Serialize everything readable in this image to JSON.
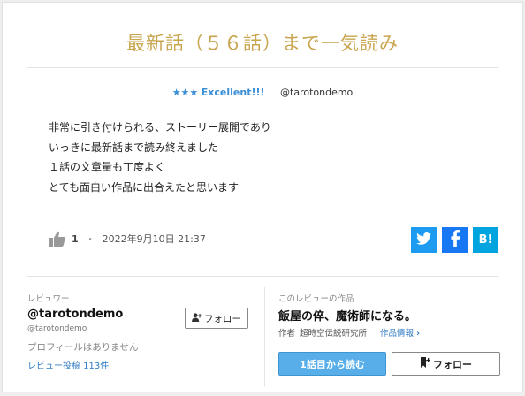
{
  "review": {
    "title": "最新話（５６話）まで一気読み",
    "stars": "★★★",
    "rating_label": "Excellent!!!",
    "reviewer_handle": "@tarotondemo",
    "body_lines": [
      "非常に引き付けられる、ストーリー展開であり",
      "いっきに最新話まで読み終えました",
      "１話の文章量も丁度よく",
      "とても面白い作品に出合えたと思います"
    ],
    "like_count": "1",
    "separator": "・",
    "date": "2022年9月10日 21:37"
  },
  "share": {
    "twitter_icon": "twitter-icon",
    "facebook_icon": "facebook-icon",
    "hatena_label": "B!"
  },
  "reviewer": {
    "section_label": "レビュワー",
    "name": "@tarotondemo",
    "handle": "@tarotondemo",
    "profile_text": "プロフィールはありません",
    "posts_text": "レビュー投稿 113件",
    "follow_label": "フォロー"
  },
  "work": {
    "section_label": "このレビューの作品",
    "title": "飯屋の倅、魔術師になる。",
    "author_prefix": "作者",
    "author": "超時空伝説研究所",
    "info_link": "作品情報",
    "read_button": "1話目から読む",
    "follow_button": "フォロー"
  },
  "colors": {
    "title_gold": "#c9a54f",
    "accent_blue": "#3b8fd6",
    "read_button_bg": "#58aee8"
  }
}
